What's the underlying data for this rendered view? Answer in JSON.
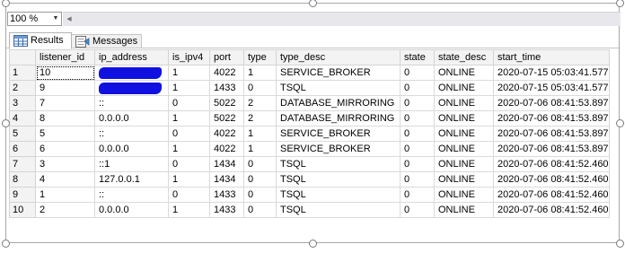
{
  "toolbar": {
    "zoom_value": "100 %",
    "zoom_arrow_icon": "chevron-down-icon",
    "scroll_left_icon": "triangle-left-icon"
  },
  "tabs": [
    {
      "label": "Results",
      "icon": "grid-icon",
      "active": true
    },
    {
      "label": "Messages",
      "icon": "message-icon",
      "active": false
    }
  ],
  "colors": {
    "redaction": "#1010e0",
    "header_bg": "#f3f3f3",
    "gridline": "#dadada"
  },
  "grid": {
    "columns": [
      "listener_id",
      "ip_address",
      "is_ipv4",
      "port",
      "type",
      "type_desc",
      "state",
      "state_desc",
      "start_time"
    ],
    "rows": [
      {
        "num": "1",
        "cells": [
          "10",
          "",
          "1",
          "4022",
          "1",
          "SERVICE_BROKER",
          "0",
          "ONLINE",
          "2020-07-15 05:03:41.577"
        ],
        "redacted": true
      },
      {
        "num": "2",
        "cells": [
          "9",
          "",
          "1",
          "1433",
          "0",
          "TSQL",
          "0",
          "ONLINE",
          "2020-07-15 05:03:41.577"
        ],
        "redacted": true
      },
      {
        "num": "3",
        "cells": [
          "7",
          "::",
          "0",
          "5022",
          "2",
          "DATABASE_MIRRORING",
          "0",
          "ONLINE",
          "2020-07-06 08:41:53.897"
        ]
      },
      {
        "num": "4",
        "cells": [
          "8",
          "0.0.0.0",
          "1",
          "5022",
          "2",
          "DATABASE_MIRRORING",
          "0",
          "ONLINE",
          "2020-07-06 08:41:53.897"
        ]
      },
      {
        "num": "5",
        "cells": [
          "5",
          "::",
          "0",
          "4022",
          "1",
          "SERVICE_BROKER",
          "0",
          "ONLINE",
          "2020-07-06 08:41:53.897"
        ]
      },
      {
        "num": "6",
        "cells": [
          "6",
          "0.0.0.0",
          "1",
          "4022",
          "1",
          "SERVICE_BROKER",
          "0",
          "ONLINE",
          "2020-07-06 08:41:53.897"
        ]
      },
      {
        "num": "7",
        "cells": [
          "3",
          "::1",
          "0",
          "1434",
          "0",
          "TSQL",
          "0",
          "ONLINE",
          "2020-07-06 08:41:52.460"
        ]
      },
      {
        "num": "8",
        "cells": [
          "4",
          "127.0.0.1",
          "1",
          "1434",
          "0",
          "TSQL",
          "0",
          "ONLINE",
          "2020-07-06 08:41:52.460"
        ]
      },
      {
        "num": "9",
        "cells": [
          "1",
          "::",
          "0",
          "1433",
          "0",
          "TSQL",
          "0",
          "ONLINE",
          "2020-07-06 08:41:52.460"
        ]
      },
      {
        "num": "10",
        "cells": [
          "2",
          "0.0.0.0",
          "1",
          "1433",
          "0",
          "TSQL",
          "0",
          "ONLINE",
          "2020-07-06 08:41:52.460"
        ]
      }
    ]
  }
}
